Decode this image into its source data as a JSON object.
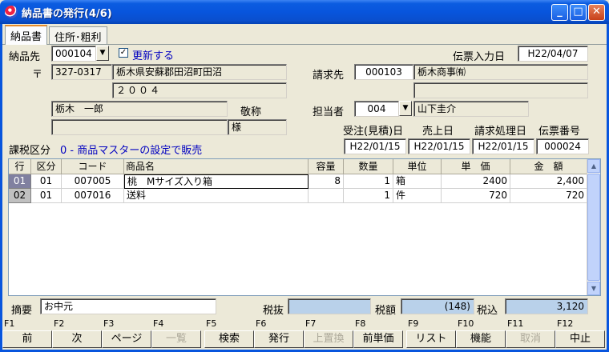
{
  "window": {
    "title": "納品書の発行(4/6)",
    "minimize": "_",
    "maximize": "□",
    "close": "✕"
  },
  "tabs": [
    {
      "label": "納品書"
    },
    {
      "label": "住所･粗利"
    }
  ],
  "customer": {
    "label": "納品先",
    "code": "000104",
    "update_label": "更新する",
    "update_checked": true,
    "postal_mark": "〒",
    "postal_code": "327-0317",
    "address1": "栃木県安蘇郡田沼町田沼",
    "address2": "２００４",
    "name": "栃木　一郎",
    "honorific_label": "敬称",
    "honorific": "様",
    "extra": ""
  },
  "slip_date": {
    "label": "伝票入力日",
    "value": "H22/04/07"
  },
  "billing": {
    "label": "請求先",
    "code": "000103",
    "name": "栃木商事㈲",
    "name2": ""
  },
  "staff": {
    "label": "担当者",
    "code": "004",
    "name": "山下圭介"
  },
  "dates": {
    "order_label": "受注(見積)日",
    "order": "H22/01/15",
    "sales_label": "売上日",
    "sales": "H22/01/15",
    "billing_label": "請求処理日",
    "billing": "H22/01/15",
    "slip_no_label": "伝票番号",
    "slip_no": "000024"
  },
  "tax_class": {
    "label": "課税区分",
    "value": "0 - 商品マスターの設定で販売"
  },
  "table": {
    "headers": [
      "行",
      "区分",
      "コード",
      "商品名",
      "容量",
      "数量",
      "単位",
      "単　価",
      "金　額"
    ],
    "rows": [
      {
        "row": "01",
        "kubun": "01",
        "code": "007005",
        "name": "桃　Mサイズ入り箱",
        "capacity": "8",
        "qty": "1",
        "unit": "箱",
        "price": "2400",
        "amount": "2,400"
      },
      {
        "row": "02",
        "kubun": "01",
        "code": "007016",
        "name": "送料",
        "capacity": "",
        "qty": "1",
        "unit": "件",
        "price": "720",
        "amount": "720"
      }
    ]
  },
  "footer": {
    "memo_label": "摘要",
    "memo": "お中元",
    "pretax_label": "税抜",
    "pretax": "",
    "tax_label": "税額",
    "tax": "(148)",
    "total_label": "税込",
    "total": "3,120"
  },
  "fkeys": [
    {
      "key": "F1",
      "label": "前",
      "enabled": true
    },
    {
      "key": "F2",
      "label": "次",
      "enabled": true
    },
    {
      "key": "F3",
      "label": "ページ",
      "enabled": true
    },
    {
      "key": "F4",
      "label": "一覧",
      "enabled": false
    },
    {
      "key": "F5",
      "label": "検索",
      "enabled": true
    },
    {
      "key": "F6",
      "label": "発行",
      "enabled": true
    },
    {
      "key": "F7",
      "label": "上置換",
      "enabled": false
    },
    {
      "key": "F8",
      "label": "前単価",
      "enabled": true
    },
    {
      "key": "F9",
      "label": "リスト",
      "enabled": true
    },
    {
      "key": "F10",
      "label": "機能",
      "enabled": true
    },
    {
      "key": "F11",
      "label": "取消",
      "enabled": false
    },
    {
      "key": "F12",
      "label": "中止",
      "enabled": true
    }
  ]
}
